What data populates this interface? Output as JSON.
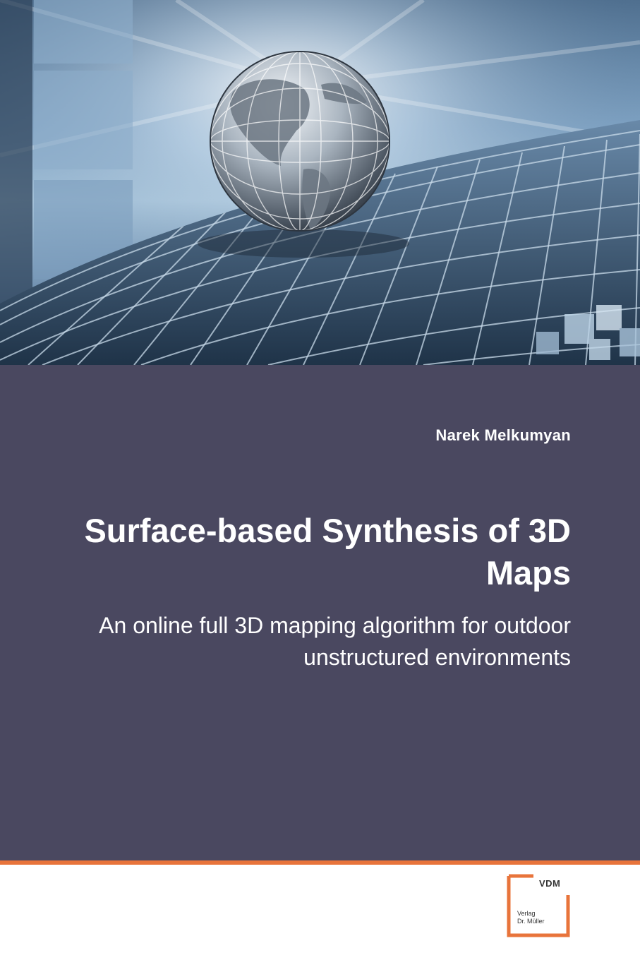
{
  "book": {
    "author": "Narek Melkumyan",
    "title": "Surface-based Synthesis of 3D Maps",
    "subtitle": "An online full 3D mapping algorithm for outdoor unstructured environments"
  },
  "publisher": {
    "logo_text": "VDM",
    "line1": "Verlag",
    "line2": "Dr. Müller"
  },
  "colors": {
    "panel": "#4a4860",
    "accent": "#e8743b",
    "sky": "#7fa3c4"
  },
  "illustration": {
    "icons": [
      "globe-icon",
      "grid-floor-icon",
      "window-frame-icon",
      "cube-cluster-icon"
    ]
  }
}
